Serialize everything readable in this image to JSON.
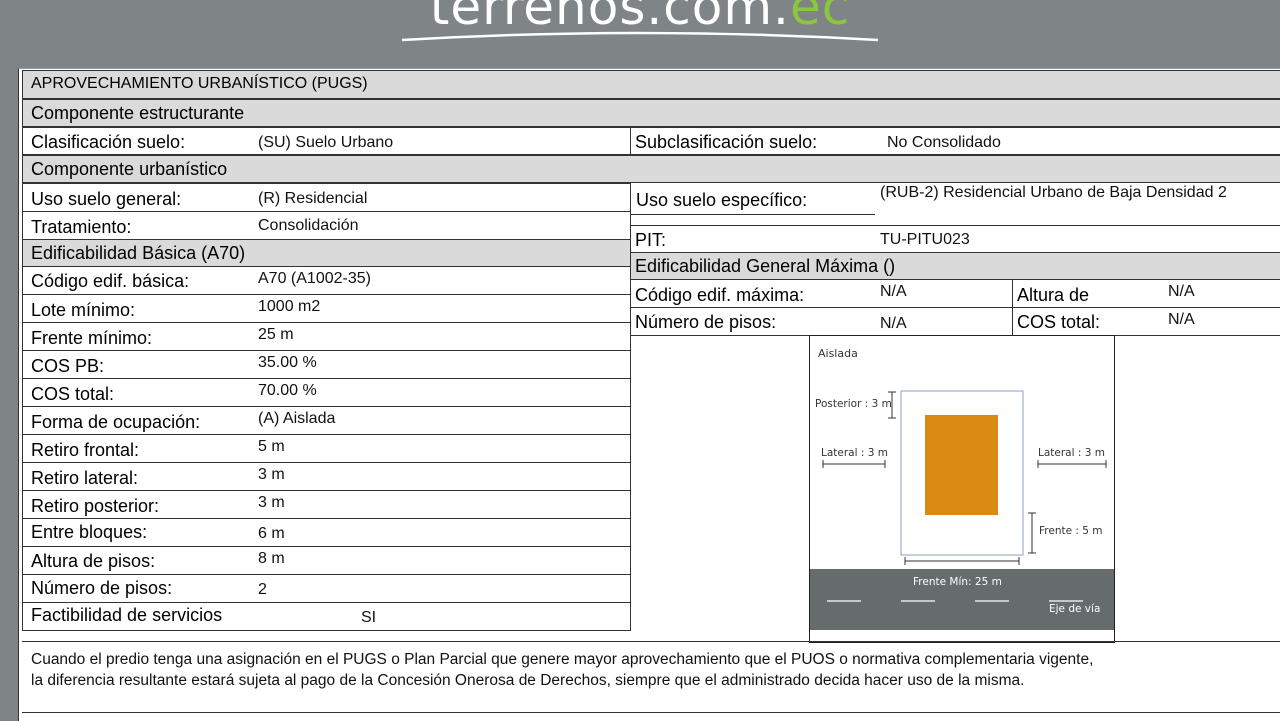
{
  "brand": {
    "logo_main": "terrenos.com.",
    "logo_suffix": "ec",
    "accent_color": "#8cc63f"
  },
  "document": {
    "header": "APROVECHAMIENTO URBANÍSTICO (PUGS)",
    "section_structural": "Componente  estructurante",
    "clasificacion_label": "Clasificación suelo:",
    "clasificacion_value": "(SU) Suelo Urbano",
    "subclasificacion_label": "Subclasificación suelo:",
    "subclasificacion_value": "No Consolidado",
    "section_urban": "Componente  urbanístico",
    "uso_general_label": "Uso suelo general:",
    "uso_general_value": "(R) Residencial",
    "uso_especifico_label": "Uso suelo específico:",
    "uso_especifico_value": "(RUB-2) Residencial Urbano de Baja Densidad 2",
    "tratamiento_label": "Tratamiento:",
    "tratamiento_value": "Consolidación",
    "pit_label": "PIT:",
    "pit_value": "TU-PITU023",
    "edif_basica_title": "Edificabilidad Básica (A70)",
    "edif_maxima_title": "Edificabilidad General Máxima ()",
    "basic_rows": [
      {
        "label": "Código edif. básica:",
        "value": "A70 (A1002-35)"
      },
      {
        "label": "Lote mínimo:",
        "value": "1000 m2"
      },
      {
        "label": "Frente mínimo:",
        "value": "25 m"
      },
      {
        "label": "COS PB:",
        "value": "35.00 %"
      },
      {
        "label": "COS total:",
        "value": "70.00 %"
      },
      {
        "label": "Forma de ocupación:",
        "value": "(A) Aislada"
      },
      {
        "label": "Retiro frontal:",
        "value": "5 m"
      },
      {
        "label": "Retiro lateral:",
        "value": "3 m"
      },
      {
        "label": "Retiro posterior:",
        "value": "3 m"
      },
      {
        "label": "Entre bloques:",
        "value": "6 m"
      },
      {
        "label": "Altura de pisos:",
        "value": "8 m"
      },
      {
        "label": "Número de pisos:",
        "value": "2"
      },
      {
        "label": "Factibilidad de servicios",
        "value": "SI"
      }
    ],
    "max": {
      "codigo_label": "Código edif. máxima:",
      "codigo_value": "N/A",
      "altura_label": "Altura de",
      "altura_value": "N/A",
      "pisos_label": "Número de pisos:",
      "pisos_value": "N/A",
      "cos_label": "COS total:",
      "cos_value": "N/A"
    },
    "diagram": {
      "title": "Aislada",
      "posterior": "Posterior : 3 m",
      "lateral_left": "Lateral : 3 m",
      "lateral_right": "Lateral : 3 m",
      "frente": "Frente : 5 m",
      "frente_min": "Frente Mín: 25 m",
      "eje_via": "Eje de vía",
      "building_color": "#d98a12"
    },
    "note_line1": "Cuando el predio tenga una asignación en el PUGS o Plan Parcial que genere mayor aprovechamiento que el PUOS o normativa complementaria vigente,",
    "note_line2": "la diferencia resultante estará sujeta al pago de la Concesión Onerosa de Derechos, siempre que el administrado decida hacer uso de la misma."
  }
}
